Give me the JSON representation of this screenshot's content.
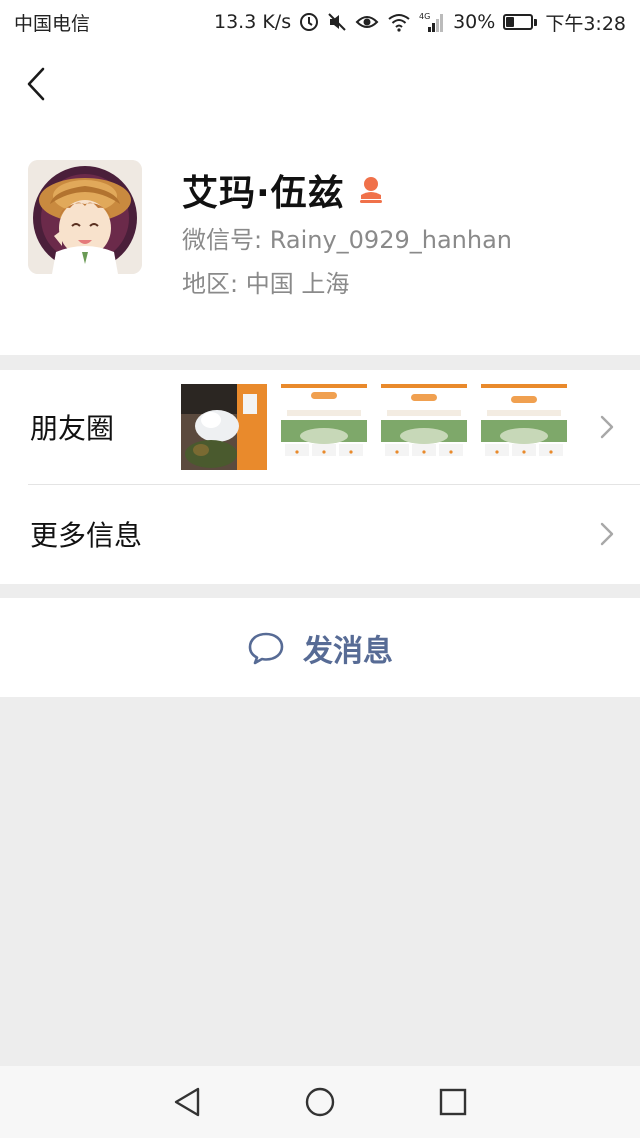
{
  "status_bar": {
    "carrier": "中国电信",
    "net_speed": "13.3 K/s",
    "network_type": "4G",
    "battery_percent_text": "30%",
    "battery_level": 0.3,
    "time": "下午3:28"
  },
  "profile": {
    "name": "艾玛·伍兹",
    "wechat_id": "微信号: Rainy_0929_hanhan",
    "region": "地区: 中国 上海"
  },
  "rows": {
    "moments_label": "朋友圈",
    "more_info_label": "更多信息"
  },
  "actions": {
    "send_message_label": "发消息"
  },
  "colors": {
    "accent_blue": "#576b95",
    "gender_icon": "#f0714a",
    "background": "#ededed"
  },
  "icons": {
    "back": "back-arrow-icon",
    "chevron": "chevron-right-icon",
    "chat": "chat-bubble-icon",
    "gender": "female-person-icon"
  }
}
